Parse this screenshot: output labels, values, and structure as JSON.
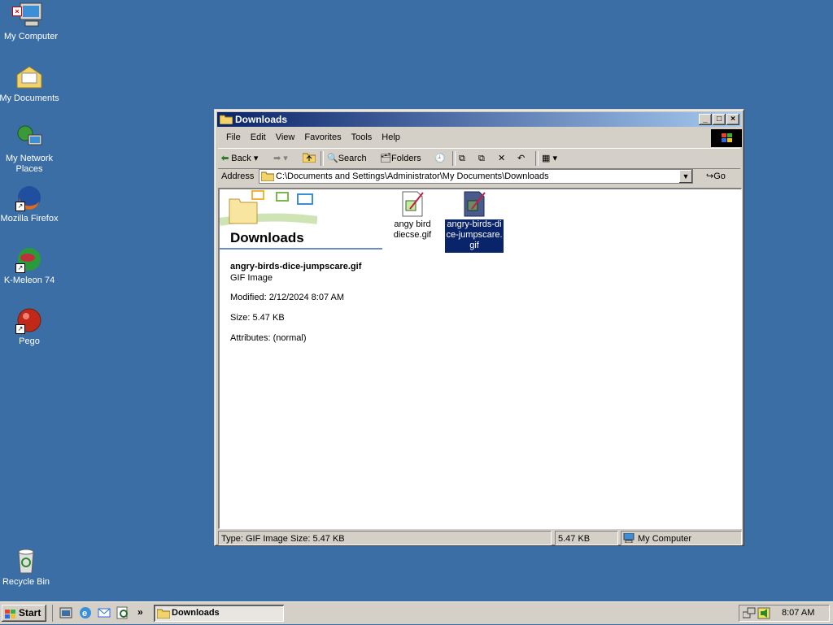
{
  "desktop": {
    "icons": [
      {
        "label": "My Computer"
      },
      {
        "label": "My Documents"
      },
      {
        "label": "My Network Places"
      },
      {
        "label": "Mozilla Firefox"
      },
      {
        "label": "K-Meleon 74"
      },
      {
        "label": "Pego"
      },
      {
        "label": "Recycle Bin"
      }
    ]
  },
  "window": {
    "title": "Downloads",
    "menu": [
      "File",
      "Edit",
      "View",
      "Favorites",
      "Tools",
      "Help"
    ],
    "toolbar": {
      "back": "Back",
      "search": "Search",
      "folders": "Folders"
    },
    "address": {
      "label": "Address",
      "value": "C:\\Documents and Settings\\Administrator\\My Documents\\Downloads",
      "go": "Go"
    },
    "panel": {
      "heading": "Downloads",
      "filename": "angry-birds-dice-jumpscare.gif",
      "filetype": "GIF Image",
      "modified": "Modified: 2/12/2024 8:07 AM",
      "size": "Size: 5.47 KB",
      "attributes": "Attributes: (normal)"
    },
    "files": [
      {
        "name": "angy bird diecse.gif",
        "selected": false
      },
      {
        "name": "angry-birds-dice-jumpscare.gif",
        "selected": true
      }
    ],
    "status": {
      "info": "Type: GIF Image Size: 5.47 KB",
      "size": "5.47 KB",
      "location": "My Computer"
    }
  },
  "taskbar": {
    "start": "Start",
    "task": "Downloads",
    "clock": "8:07 AM",
    "chevron": "»"
  }
}
